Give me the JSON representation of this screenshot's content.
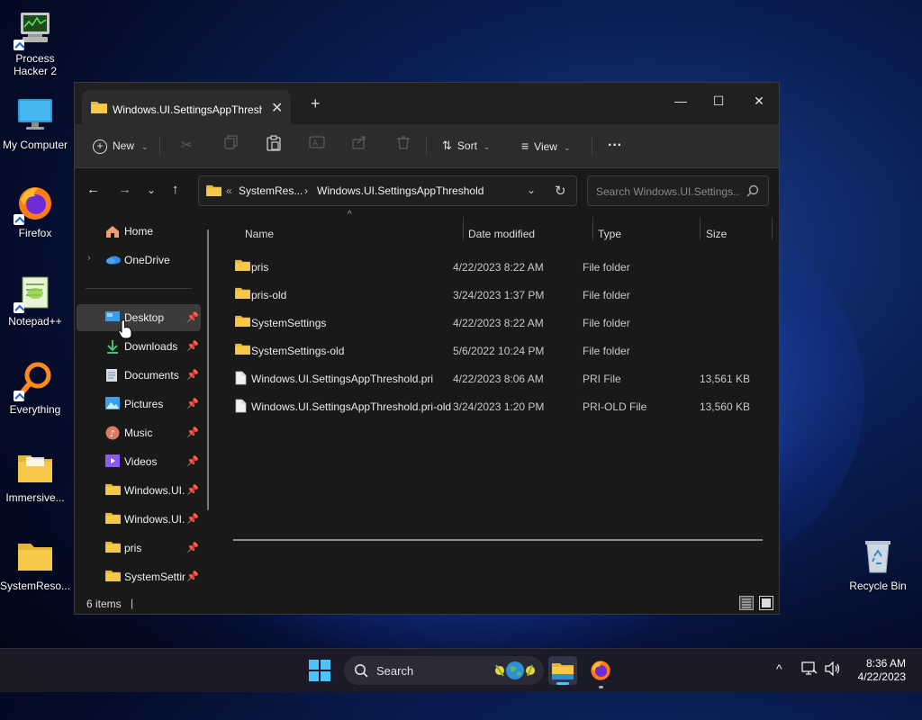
{
  "desktop": {
    "icons": [
      {
        "label": "Process\nHacker 2",
        "line1": "Process",
        "line2": "Hacker 2"
      },
      {
        "label": "My Computer"
      },
      {
        "label": "Firefox"
      },
      {
        "label": "Notepad++"
      },
      {
        "label": "Everything"
      },
      {
        "label": "Immersive..."
      },
      {
        "label": "SystemReso..."
      },
      {
        "label": "Recycle Bin"
      }
    ]
  },
  "window": {
    "tab_title": "Windows.UI.SettingsAppThreshold",
    "new_tab": "+",
    "controls": {
      "minimize": "—",
      "maximize": "☐",
      "close": "✕"
    }
  },
  "commandbar": {
    "new_label": "New",
    "sort_label": "Sort",
    "view_label": "View",
    "more_label": "···"
  },
  "address": {
    "prefix": "«",
    "crumbs": [
      "SystemRes...",
      "Windows.UI.SettingsAppThreshold"
    ],
    "separator": "›"
  },
  "search": {
    "placeholder": "Search Windows.UI.Settings..."
  },
  "nav": {
    "items": [
      {
        "label": "Home",
        "pinned": false
      },
      {
        "label": "OneDrive",
        "pinned": false
      },
      {
        "label": "Desktop",
        "pinned": true
      },
      {
        "label": "Downloads",
        "pinned": true
      },
      {
        "label": "Documents",
        "pinned": true
      },
      {
        "label": "Pictures",
        "pinned": true
      },
      {
        "label": "Music",
        "pinned": true
      },
      {
        "label": "Videos",
        "pinned": true
      },
      {
        "label": "Windows.UI.S",
        "pinned": true
      },
      {
        "label": "Windows.UI.S",
        "pinned": true
      },
      {
        "label": "pris",
        "pinned": true
      },
      {
        "label": "SystemSettin",
        "pinned": true
      }
    ]
  },
  "columns": {
    "name": "Name",
    "date": "Date modified",
    "type": "Type",
    "size": "Size"
  },
  "files": [
    {
      "name": "pris",
      "date": "4/22/2023 8:22 AM",
      "type": "File folder",
      "size": "",
      "kind": "folder"
    },
    {
      "name": "pris-old",
      "date": "3/24/2023 1:37 PM",
      "type": "File folder",
      "size": "",
      "kind": "folder"
    },
    {
      "name": "SystemSettings",
      "date": "4/22/2023 8:22 AM",
      "type": "File folder",
      "size": "",
      "kind": "folder"
    },
    {
      "name": "SystemSettings-old",
      "date": "5/6/2022 10:24 PM",
      "type": "File folder",
      "size": "",
      "kind": "folder"
    },
    {
      "name": "Windows.UI.SettingsAppThreshold.pri",
      "date": "4/22/2023 8:06 AM",
      "type": "PRI File",
      "size": "13,561 KB",
      "kind": "file"
    },
    {
      "name": "Windows.UI.SettingsAppThreshold.pri-old",
      "date": "3/24/2023 1:20 PM",
      "type": "PRI-OLD File",
      "size": "13,560 KB",
      "kind": "file"
    }
  ],
  "status": {
    "item_count": "6 items"
  },
  "taskbar": {
    "search_label": "Search",
    "time": "8:36 AM",
    "date": "4/22/2023"
  },
  "colors": {
    "accent": "#4cc2ff",
    "folder": "#f7c948",
    "window_bg": "#191919"
  }
}
